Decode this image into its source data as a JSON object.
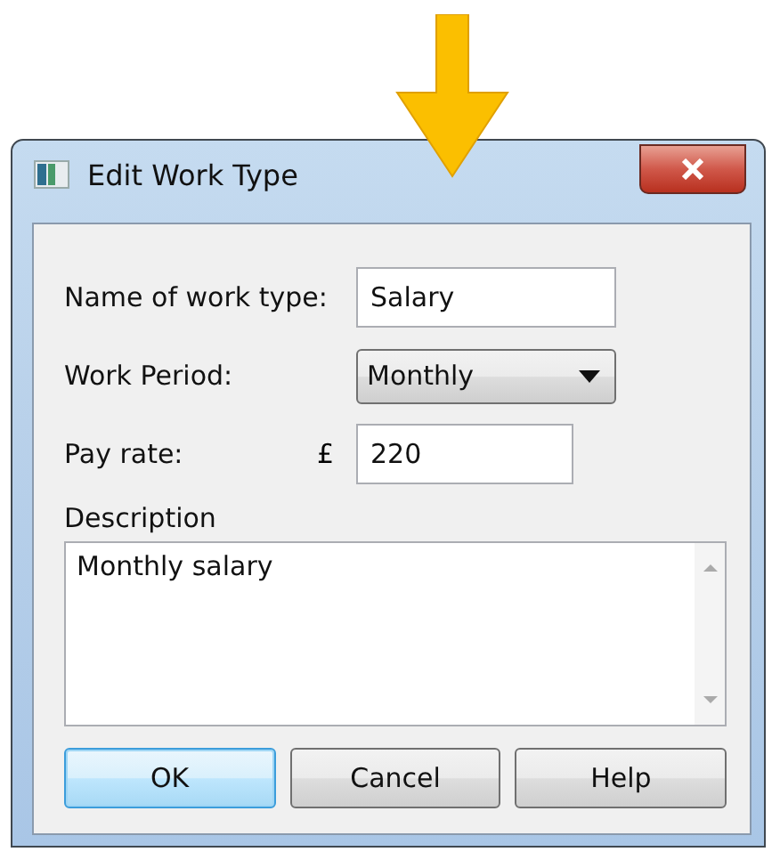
{
  "window": {
    "title": "Edit Work Type"
  },
  "fields": [
    {
      "kind": "text",
      "label": "Name of work type:",
      "value": "Salary"
    },
    {
      "kind": "dropdown",
      "label": "Work Period:",
      "value": "Monthly"
    },
    {
      "kind": "currency",
      "label": "Pay rate:",
      "prefix": "£",
      "value": "220"
    }
  ],
  "description": {
    "label": "Description",
    "value": "Monthly salary"
  },
  "buttons": [
    {
      "label": "OK",
      "default": true
    },
    {
      "label": "Cancel",
      "default": false
    },
    {
      "label": "Help",
      "default": false
    }
  ]
}
